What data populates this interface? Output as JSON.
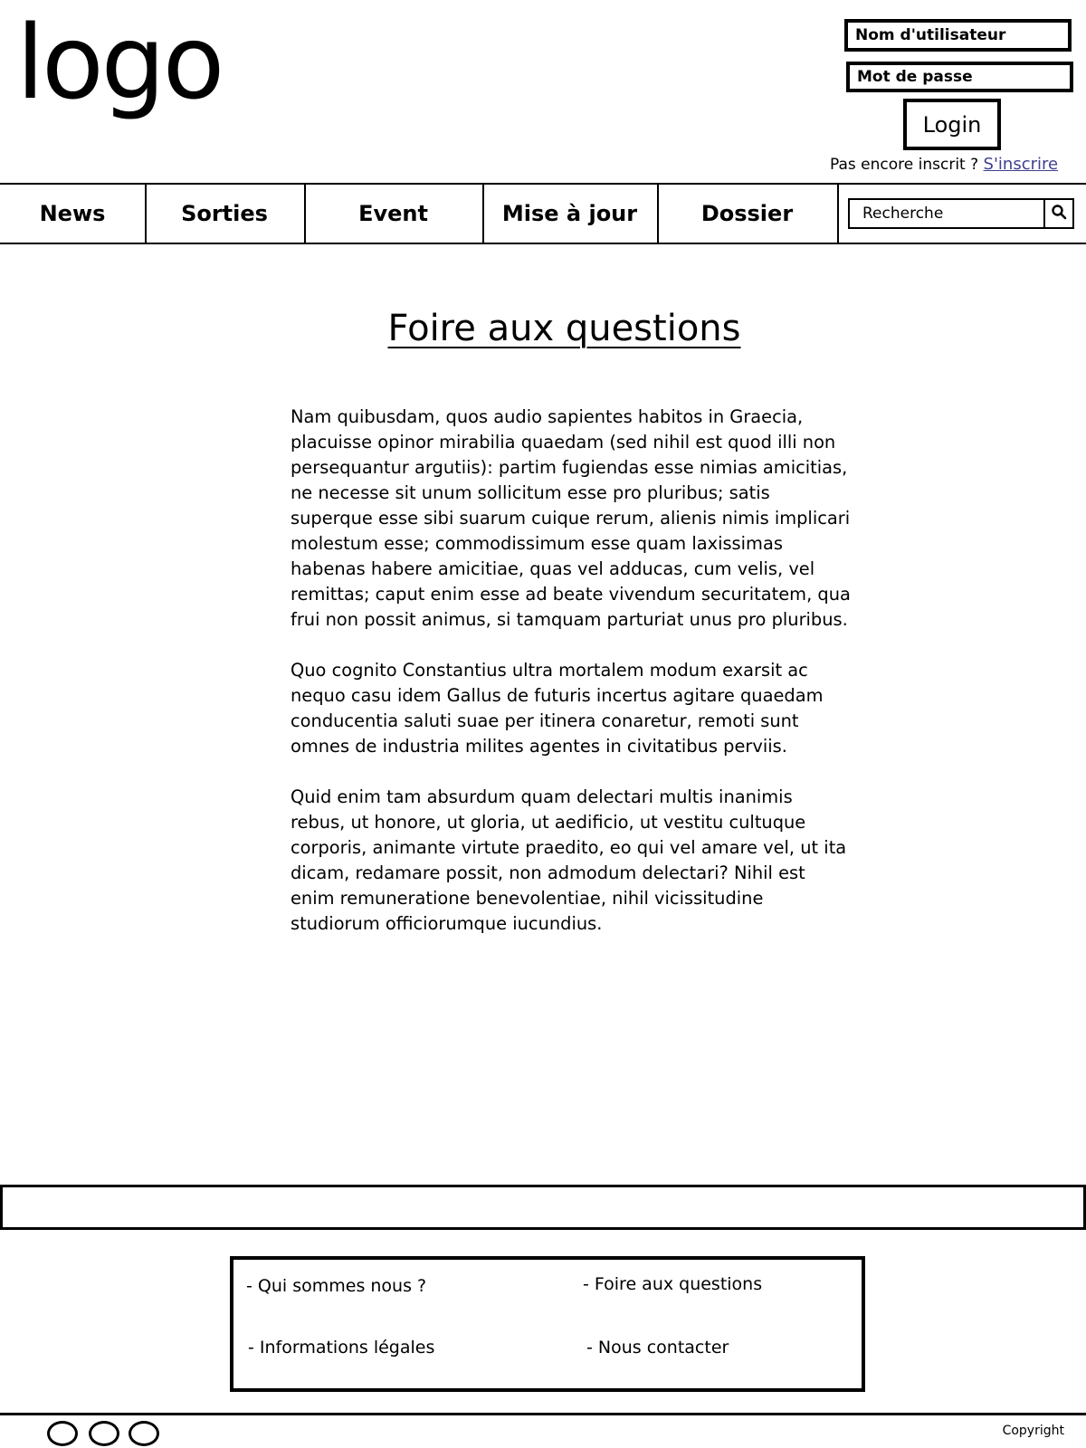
{
  "header": {
    "logo_text": "logo",
    "username_placeholder": "Nom d'utilisateur",
    "password_placeholder": "Mot de passe",
    "login_label": "Login",
    "register_prompt": "Pas encore inscrit ?",
    "register_link": "S'inscrire"
  },
  "nav": {
    "items": [
      {
        "label": "News"
      },
      {
        "label": "Sorties"
      },
      {
        "label": "Event"
      },
      {
        "label": "Mise à jour"
      },
      {
        "label": "Dossier"
      }
    ],
    "search_placeholder": "Recherche",
    "search_icon": "search-icon"
  },
  "main": {
    "title": "Foire aux questions",
    "paragraphs": [
      "Nam quibusdam, quos audio sapientes habitos in Graecia, placuisse opinor mirabilia quaedam (sed nihil est quod illi non persequantur argutiis): partim fugiendas esse nimias amicitias, ne necesse sit unum sollicitum esse pro pluribus; satis superque esse sibi suarum cuique rerum, alienis nimis implicari molestum esse; commodissimum esse quam laxissimas habenas habere amicitiae, quas vel adducas, cum velis, vel remittas; caput enim esse ad beate vivendum securitatem, qua frui non possit animus, si tamquam parturiat unus pro pluribus.",
      "Quo cognito Constantius ultra mortalem modum exarsit ac nequo casu idem Gallus de futuris incertus agitare quaedam conducentia saluti suae per itinera conaretur, remoti sunt omnes de industria milites agentes in civitatibus perviis.",
      "Quid enim tam absurdum quam delectari multis inanimis rebus, ut honore, ut gloria, ut aedificio, ut vestitu cultuque corporis, animante virtute praedito, eo qui vel amare vel, ut ita dicam, redamare possit, non admodum delectari? Nihil est enim remuneratione benevolentiae, nihil vicissitudine studiorum officiorumque iucundius."
    ]
  },
  "footer": {
    "links": [
      {
        "label": "- Qui sommes nous ?"
      },
      {
        "label": "- Foire aux questions"
      },
      {
        "label": "- Informations légales"
      },
      {
        "label": "- Nous contacter"
      }
    ],
    "social_icons": [
      "social-icon",
      "social-icon",
      "social-icon"
    ],
    "copyright": "Copyright"
  }
}
